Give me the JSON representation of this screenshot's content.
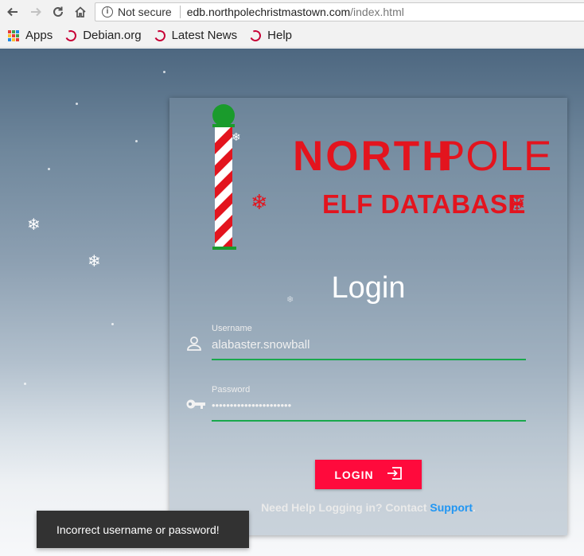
{
  "browser": {
    "security_label": "Not secure",
    "url_host": "edb.northpolechristmastown.com",
    "url_path": "/index.html"
  },
  "bookmarks": [
    {
      "label": "Apps",
      "icon": "apps-grid-icon"
    },
    {
      "label": "Debian.org",
      "icon": "debian-icon"
    },
    {
      "label": "Latest News",
      "icon": "debian-icon"
    },
    {
      "label": "Help",
      "icon": "debian-icon"
    }
  ],
  "logo": {
    "line1_bold": "NORTH",
    "line1_light": "POLE",
    "line2": "ELF DATABASE"
  },
  "login": {
    "title": "Login",
    "username_label": "Username",
    "username_value": "alabaster.snowball",
    "password_label": "Password",
    "password_value": "••••••••••••••••••••••",
    "button_label": "LOGIN",
    "help_text": "Need Help Logging in? Contact ",
    "help_link": "Support",
    "help_suffix": "."
  },
  "toast": {
    "message": "Incorrect username or password!"
  },
  "colors": {
    "brand_red": "#e3141e",
    "button_red": "#ff0a3c",
    "field_underline": "#19a84c",
    "link_blue": "#2196f3",
    "pole_green": "#1a9b2c"
  }
}
